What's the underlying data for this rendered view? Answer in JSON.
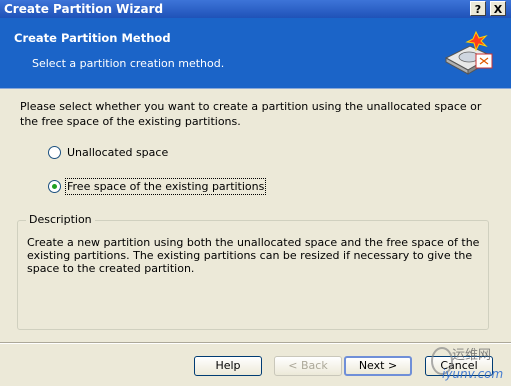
{
  "window": {
    "title": "Create Partition Wizard",
    "help_glyph": "?",
    "close_glyph": "X"
  },
  "header": {
    "title": "Create Partition Method",
    "subtitle": "Select a partition creation method.",
    "icon": "partition-wizard-icon"
  },
  "body": {
    "intro": "Please select whether you want to create a partition using the unallocated space or the free space of the existing partitions.",
    "options": [
      {
        "label": "Unallocated space",
        "checked": false
      },
      {
        "label": "Free space of the existing partitions",
        "checked": true
      }
    ],
    "description": {
      "legend": "Description",
      "text": "Create a new partition using both the unallocated space and the free space of the existing partitions. The existing partitions can be resized if necessary to give the space to the created partition."
    }
  },
  "footer": {
    "help_label": "Help",
    "back_label": "< Back",
    "next_label": "Next >",
    "cancel_label": "Cancel"
  },
  "watermark": {
    "cn": "运维网",
    "en": "iyunv.com"
  },
  "colors": {
    "header_bg": "#1b64c8",
    "titlebar": "#2a5fc8",
    "radio_dot": "#21a121",
    "dialog_bg": "#ece9d8"
  }
}
